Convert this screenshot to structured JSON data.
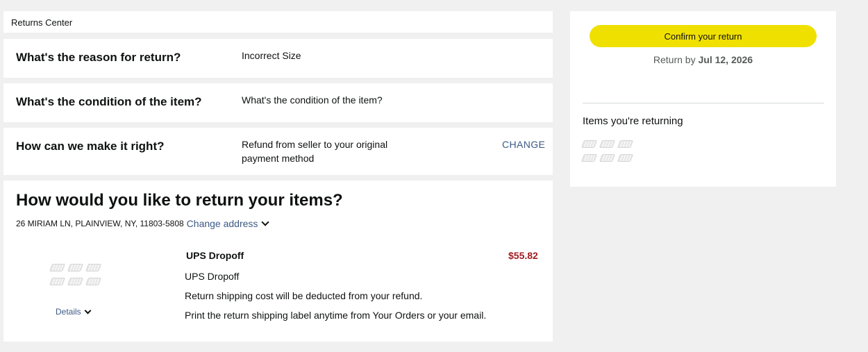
{
  "header": {
    "title": "Returns Center"
  },
  "questions": {
    "reason": {
      "label": "What's the reason for return?",
      "answer": "Incorrect Size"
    },
    "condition": {
      "label": "What's the condition of the item?",
      "answer": "What's the condition of the item?"
    },
    "remedy": {
      "label": "How can we make it right?",
      "answer": "Refund from seller to your original payment method",
      "change_label": "CHANGE"
    }
  },
  "method": {
    "title": "How would you like to return your items?",
    "address": "26 MIRIAM LN, PLAINVIEW, NY, 11803-5808",
    "change_address_label": "Change address",
    "details_label": "Details",
    "option": {
      "title": "UPS Dropoff",
      "price": "$55.82",
      "lines": [
        "UPS Dropoff",
        "Return shipping cost will be deducted from your refund.",
        "Print the return shipping label anytime from Your Orders or your email."
      ]
    }
  },
  "summary": {
    "confirm_label": "Confirm your return",
    "return_by_prefix": "Return by",
    "return_by_date": "Jul 12, 2026",
    "items_heading": "Items you're returning"
  },
  "icons": {
    "chevron": "chevron-down-icon",
    "item_thumbnail": "item-thumbnail-icon"
  },
  "colors": {
    "confirm_button": "#f0e000",
    "link": "#3b5a85",
    "price": "#a11d20",
    "page_background": "#eff0ef"
  }
}
